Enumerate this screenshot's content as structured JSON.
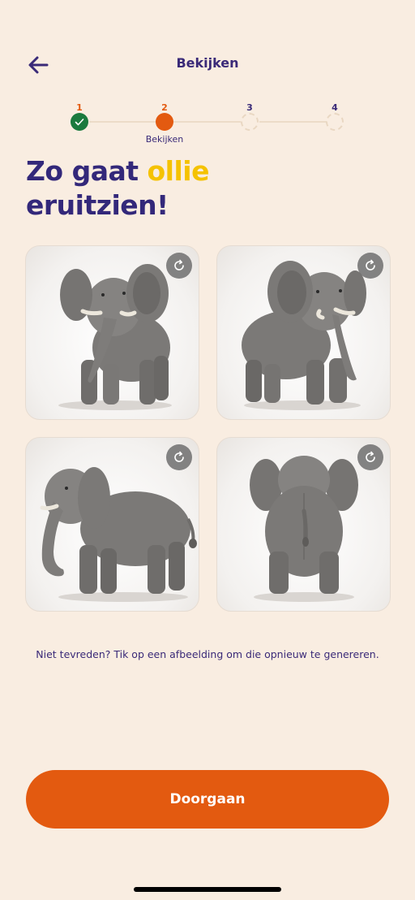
{
  "header": {
    "title": "Bekijken"
  },
  "stepper": {
    "steps": [
      {
        "number": "1",
        "state": "done"
      },
      {
        "number": "2",
        "state": "active",
        "label": "Bekijken"
      },
      {
        "number": "3",
        "state": "todo"
      },
      {
        "number": "4",
        "state": "todo"
      }
    ]
  },
  "headline": {
    "prefix": "Zo gaat ",
    "name": "ollie",
    "suffix": "eruitzien!"
  },
  "images": [
    {
      "view": "front-left",
      "icon": "refresh-icon"
    },
    {
      "view": "front-right",
      "icon": "refresh-icon"
    },
    {
      "view": "side",
      "icon": "refresh-icon"
    },
    {
      "view": "back",
      "icon": "refresh-icon"
    }
  ],
  "hint": "Niet tevreden? Tik op een afbeelding om die opnieuw te genereren.",
  "cta": {
    "label": "Doorgaan"
  },
  "colors": {
    "accent": "#e35a10",
    "primary_text": "#3a2a78",
    "highlight": "#f5c200",
    "success": "#1b7a3e",
    "background": "#f9ede1"
  }
}
